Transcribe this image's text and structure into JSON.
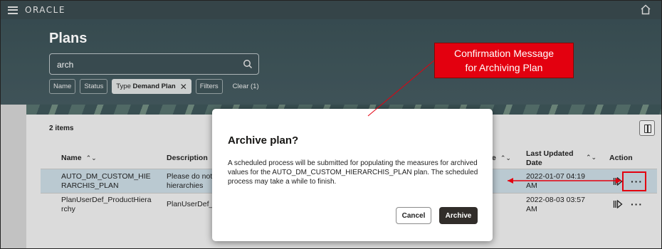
{
  "app": {
    "logo": "ORACLE"
  },
  "page": {
    "title": "Plans"
  },
  "search": {
    "value": "arch"
  },
  "filters": {
    "chips": [
      "Name",
      "Status"
    ],
    "selected_chip": {
      "prefix": "Type",
      "value": "Demand Plan"
    },
    "filters_label": "Filters",
    "clear_label": "Clear (1)"
  },
  "table": {
    "items_count": "2 items",
    "headers": {
      "name": "Name",
      "description": "Description",
      "type_partial": "e",
      "last_updated_line1": "Last Updated",
      "last_updated_line2": "Date",
      "action": "Action"
    },
    "rows": [
      {
        "name_line1": "AUTO_DM_CUSTOM_HIE",
        "name_line2": "RARCHIS_PLAN",
        "desc_line1": "Please do not",
        "desc_line2": "hierarchies",
        "date_line1": "2022-01-07 04:19",
        "date_line2": "AM"
      },
      {
        "name_line1": "PlanUserDef_ProductHiera",
        "name_line2": "rchy",
        "desc_line1": "PlanUserDef_",
        "desc_line2": "",
        "date_line1": "2022-08-03 03:57",
        "date_line2": "AM"
      }
    ],
    "more_actions_glyph": "···"
  },
  "dialog": {
    "title": "Archive plan?",
    "body": "A scheduled process will be submitted for populating the measures for archived values for the AUTO_DM_CUSTOM_HIERARCHIS_PLAN plan. The scheduled process may take a while to finish.",
    "cancel_label": "Cancel",
    "confirm_label": "Archive"
  },
  "annotation": {
    "line1": "Confirmation Message",
    "line2": "for Archiving Plan",
    "color": "#e3000f"
  }
}
